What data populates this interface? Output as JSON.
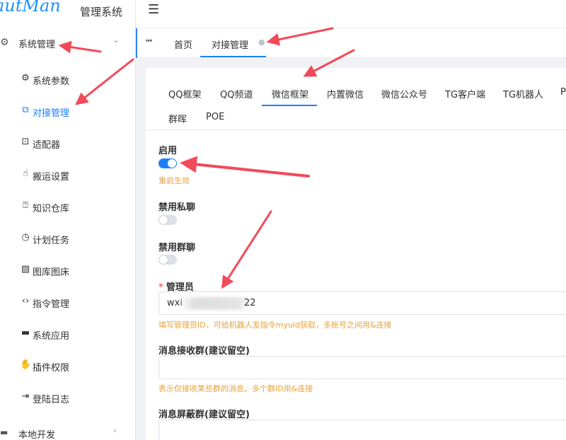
{
  "logo": {
    "brand": "autMan",
    "subtitle": "管理系统"
  },
  "topbar": {
    "menu_icon": "hamburger-icon"
  },
  "sidebar": {
    "group": {
      "label": "系统管理",
      "icon": "gear-icon"
    },
    "items": [
      {
        "label": "系统参数",
        "icon": "gear-icon",
        "active": false
      },
      {
        "label": "对接管理",
        "icon": "link-icon",
        "active": true
      },
      {
        "label": "适配器",
        "icon": "adapter-icon",
        "active": false
      },
      {
        "label": "搬运设置",
        "icon": "hand-icon",
        "active": false
      },
      {
        "label": "知识仓库",
        "icon": "chat-icon",
        "active": false
      },
      {
        "label": "计划任务",
        "icon": "clock-icon",
        "active": false
      },
      {
        "label": "图库图床",
        "icon": "image-icon",
        "active": false
      },
      {
        "label": "指令管理",
        "icon": "code-icon",
        "active": false
      },
      {
        "label": "系统应用",
        "icon": "window-icon",
        "active": false
      },
      {
        "label": "插件权限",
        "icon": "plugin-icon",
        "active": false
      },
      {
        "label": "登陆日志",
        "icon": "login-icon",
        "active": false
      }
    ],
    "bottom_group": {
      "label": "本地开发"
    }
  },
  "tags": {
    "home": "首页",
    "current": "对接管理"
  },
  "subtabs": {
    "row1": [
      "QQ框架",
      "QQ频道",
      "微信框架",
      "内置微信",
      "微信公众号",
      "TG客户端",
      "TG机器人",
      "P"
    ],
    "row2": [
      "群晖",
      "POE"
    ],
    "active": "微信框架"
  },
  "form": {
    "enable": {
      "label": "启用",
      "value": true,
      "hint": "重启生效"
    },
    "disable_private": {
      "label": "禁用私聊",
      "value": false
    },
    "disable_group": {
      "label": "禁用群聊",
      "value": false
    },
    "admin": {
      "label": "管理员",
      "required_mark": "*",
      "value_prefix": "wxi",
      "value_suffix": "22",
      "hint": "填写管理员ID，可给机器人发指令myuid获取，多账号之间用&连接"
    },
    "receive_groups": {
      "label": "消息接收群(建议留空)",
      "value": "",
      "hint": "表示仅接收某些群的消息，多个群ID用&连接"
    },
    "block_groups": {
      "label": "消息屏蔽群(建议留空)",
      "value": ""
    }
  },
  "colors": {
    "accent": "#1e7ffb",
    "hint": "#e6a23c",
    "arrow": "#f24a5a"
  }
}
